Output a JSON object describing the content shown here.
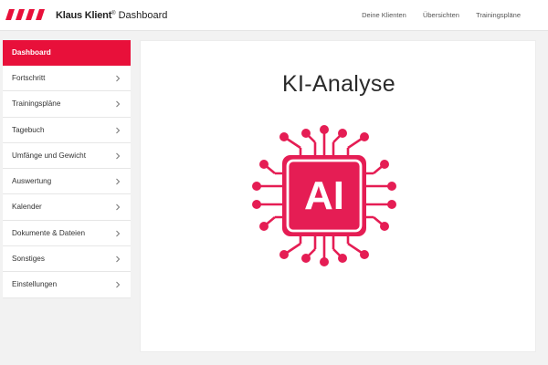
{
  "app": {
    "brand_name": "Klaus Klient",
    "brand_reg": "®",
    "brand_section": "Dashboard"
  },
  "topnav": {
    "items": [
      "Deine Klienten",
      "Übersichten",
      "Trainingspläne"
    ]
  },
  "sidebar": {
    "items": [
      {
        "label": "Dashboard",
        "active": true
      },
      {
        "label": "Fortschritt"
      },
      {
        "label": "Trainingspläne"
      },
      {
        "label": "Tagebuch"
      },
      {
        "label": "Umfänge und Gewicht"
      },
      {
        "label": "Auswertung"
      },
      {
        "label": "Kalender"
      },
      {
        "label": "Dokumente & Dateien"
      },
      {
        "label": "Sonstiges"
      },
      {
        "label": "Einstellungen"
      }
    ]
  },
  "main": {
    "title": "KI-Analyse",
    "chip_text": "AI",
    "icon": "ai-chip-icon"
  },
  "colors": {
    "accent": "#e8103a",
    "chip": "#e51d54"
  }
}
